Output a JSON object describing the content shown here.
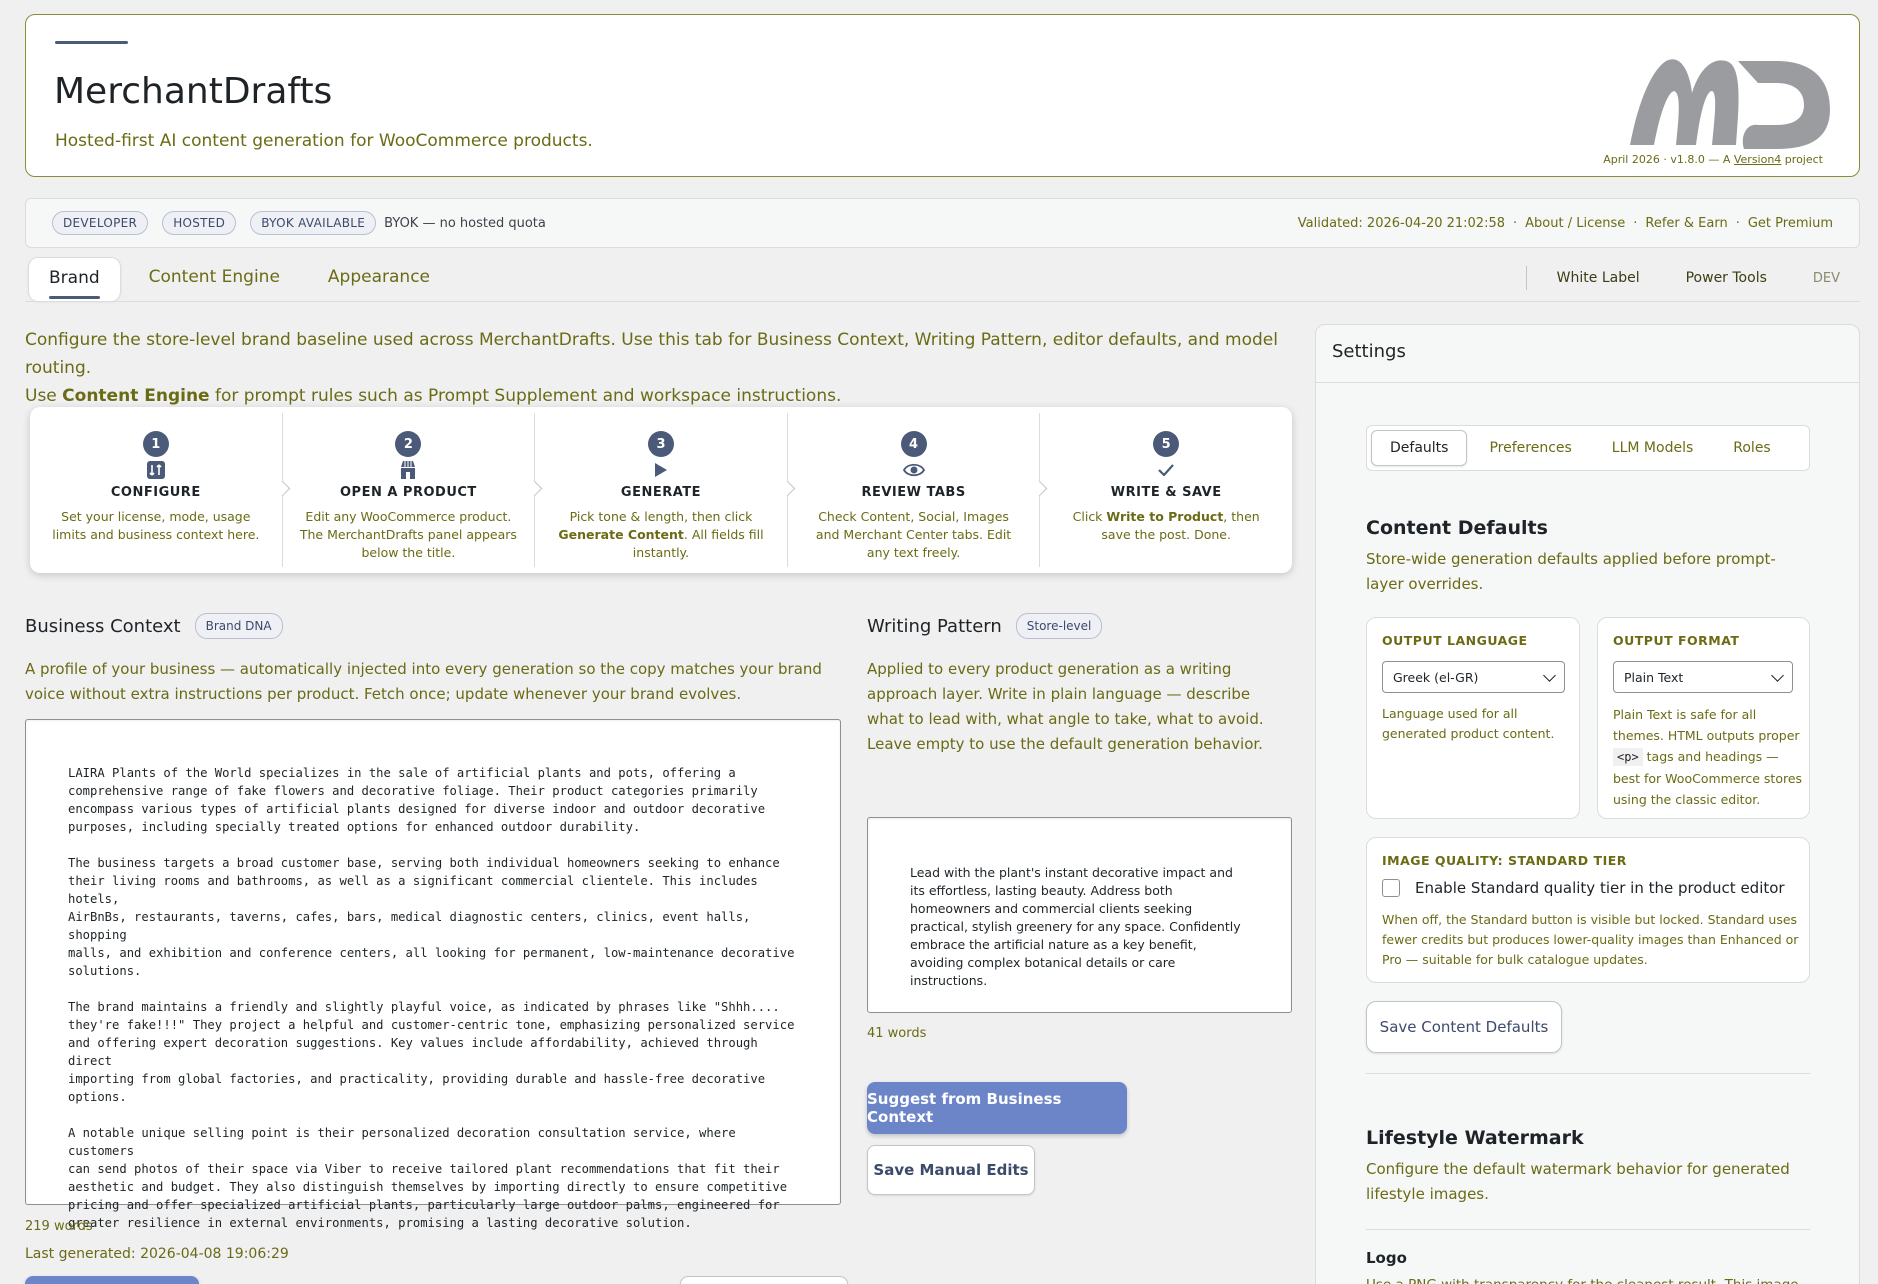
{
  "header": {
    "title": "MerchantDrafts",
    "subtitle": "Hosted-first AI content generation for WooCommerce products.",
    "version_prefix": "April 2026 · v1.8.0 — A ",
    "version_link": "Version4",
    "version_suffix": " project"
  },
  "status": {
    "pills": [
      "DEVELOPER",
      "HOSTED",
      "BYOK AVAILABLE"
    ],
    "note": "BYOK — no hosted quota",
    "validated": "Validated: 2026-04-20 21:02:58",
    "links": [
      "About / License",
      "Refer & Earn",
      "Get Premium"
    ]
  },
  "tabs": {
    "items": [
      "Brand",
      "Content Engine",
      "Appearance"
    ],
    "right": [
      "White Label",
      "Power Tools"
    ],
    "dev": "DEV"
  },
  "intro": {
    "line1": "Configure the store-level brand baseline used across MerchantDrafts. Use this tab for Business Context, Writing Pattern, editor defaults, and model routing.",
    "line2_pre": "Use ",
    "line2_bold": "Content Engine",
    "line2_post": " for prompt rules such as Prompt Supplement and workspace instructions."
  },
  "steps": [
    {
      "num": "1",
      "icon": "sliders-icon",
      "title": "CONFIGURE",
      "desc_pre": "Set your license, mode, usage limits and business context here.",
      "desc_bold": "",
      "desc_post": ""
    },
    {
      "num": "2",
      "icon": "store-icon",
      "title": "OPEN A PRODUCT",
      "desc_pre": "Edit any WooCommerce product. The MerchantDrafts panel appears below the title.",
      "desc_bold": "",
      "desc_post": ""
    },
    {
      "num": "3",
      "icon": "play-icon",
      "title": "GENERATE",
      "desc_pre": "Pick tone & length, then click ",
      "desc_bold": "Generate Content",
      "desc_post": ". All fields fill instantly."
    },
    {
      "num": "4",
      "icon": "eye-icon",
      "title": "REVIEW TABS",
      "desc_pre": "Check Content, Social, Images and Merchant Center tabs. Edit any text freely.",
      "desc_bold": "",
      "desc_post": ""
    },
    {
      "num": "5",
      "icon": "check-icon",
      "title": "WRITE & SAVE",
      "desc_pre": "Click ",
      "desc_bold": "Write to Product",
      "desc_post": ", then save the post. Done."
    }
  ],
  "business": {
    "title": "Business Context",
    "badge": "Brand DNA",
    "desc": "A profile of your business — automatically injected into every generation so the copy matches your brand voice without extra instructions per product. Fetch once; update whenever your brand evolves.",
    "text": "LAIRA Plants of the World specializes in the sale of artificial plants and pots, offering a\ncomprehensive range of fake flowers and decorative foliage. Their product categories primarily\nencompass various types of artificial plants designed for diverse indoor and outdoor decorative\npurposes, including specially treated options for enhanced outdoor durability.\n\nThe business targets a broad customer base, serving both individual homeowners seeking to enhance\ntheir living rooms and bathrooms, as well as a significant commercial clientele. This includes hotels,\nAirBnBs, restaurants, taverns, cafes, bars, medical diagnostic centers, clinics, event halls, shopping\nmalls, and exhibition and conference centers, all looking for permanent, low-maintenance decorative\nsolutions.\n\nThe brand maintains a friendly and slightly playful voice, as indicated by phrases like \"Shhh....\nthey're fake!!!\" They project a helpful and customer-centric tone, emphasizing personalized service\nand offering expert decoration suggestions. Key values include affordability, achieved through direct\nimporting from global factories, and practicality, providing durable and hassle-free decorative\noptions.\n\nA notable unique selling point is their personalized decoration consultation service, where customers\ncan send photos of their space via Viber to receive tailored plant recommendations that fit their\naesthetic and budget. They also distinguish themselves by importing directly to ensure competitive\npricing and offer specialized artificial plants, particularly large outdoor palms, engineered for\ngreater resilience in external environments, promising a lasting decorative solution.",
    "words": "219 words",
    "last_generated": "Last generated: 2026-04-08 19:06:29"
  },
  "writing": {
    "title": "Writing Pattern",
    "badge": "Store-level",
    "desc": "Applied to every product generation as a writing approach layer. Write in plain language — describe what to lead with, what angle to take, what to avoid. Leave empty to use the default generation behavior.",
    "text": "Lead with the plant's instant decorative impact and its effortless, lasting beauty. Address both homeowners and commercial clients seeking practical, stylish greenery for any space. Confidently embrace the artificial nature as a key benefit, avoiding complex botanical details or care instructions.",
    "words": "41 words",
    "suggest_btn": "Suggest from Business Context",
    "save_btn": "Save Manual Edits"
  },
  "settings": {
    "title": "Settings",
    "subtabs": [
      "Defaults",
      "Preferences",
      "LLM Models",
      "Roles"
    ],
    "content_defaults": {
      "title": "Content Defaults",
      "desc": "Store-wide generation defaults applied before prompt-layer overrides.",
      "output_language_label": "OUTPUT LANGUAGE",
      "output_language_value": "Greek (el-GR)",
      "output_language_help": "Language used for all generated product content.",
      "output_format_label": "OUTPUT FORMAT",
      "output_format_value": "Plain Text",
      "output_format_help_1": "Plain Text is safe for all themes. HTML outputs proper ",
      "output_format_code": "<p>",
      "output_format_help_2": " tags and headings — best for WooCommerce stores using the classic editor.",
      "image_quality_label": "IMAGE QUALITY: STANDARD TIER",
      "image_quality_checkbox": "Enable Standard quality tier in the product editor",
      "image_quality_help": "When off, the Standard button is visible but locked. Standard uses fewer credits but produces lower-quality images than Enhanced or Pro — suitable for bulk catalogue updates.",
      "save_btn": "Save Content Defaults"
    },
    "watermark": {
      "title": "Lifestyle Watermark",
      "desc": "Configure the default watermark behavior for generated lifestyle images.",
      "logo_label": "Logo",
      "logo_help": "Use a PNG with transparency for the cleanest result. This image is"
    }
  },
  "colors": {
    "accent": "#4b5a78",
    "primary_button": "#6b85c8",
    "olive_text": "#6b6b16"
  }
}
